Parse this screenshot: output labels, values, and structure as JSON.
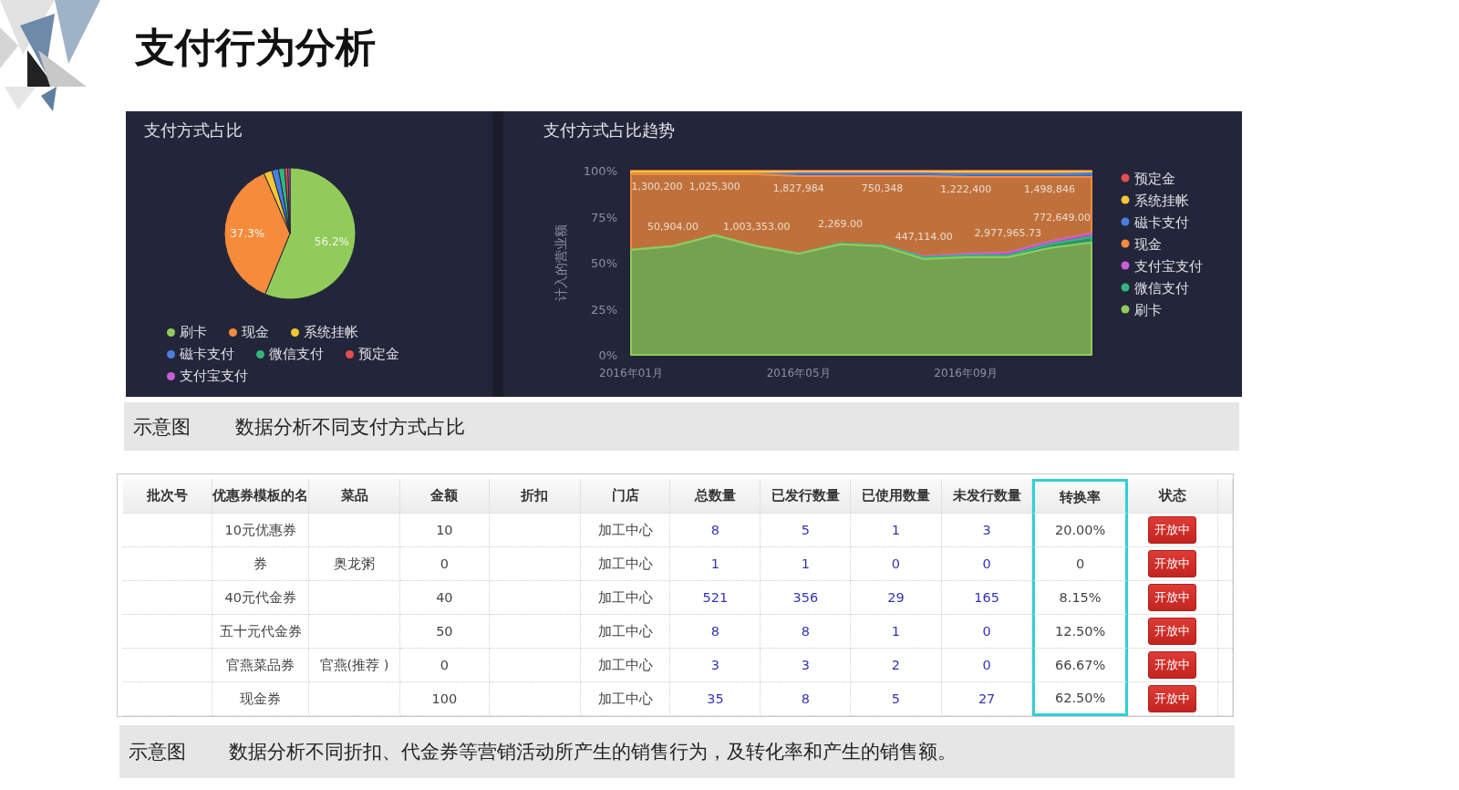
{
  "title": "支付行为分析",
  "payment_share": {
    "title": "支付方式占比",
    "slices": [
      {
        "color": "#91cc5a"
      },
      {
        "color": "#f68b3c"
      },
      {
        "color": "#f5c634"
      },
      {
        "color": "#4a7fe0"
      },
      {
        "color": "#2fb87a"
      },
      {
        "color": "#e84c4c"
      },
      {
        "color": "#c95fd6"
      }
    ],
    "chart_data": {
      "type": "pie",
      "categories": [
        "刷卡",
        "现金",
        "系统挂帐",
        "磁卡支付",
        "微信支付",
        "预定金",
        "支付宝支付"
      ],
      "values": [
        56.2,
        37.3,
        2.0,
        1.7,
        1.5,
        0.8,
        0.5
      ],
      "value_labels": [
        "56.2%",
        "37.3%",
        null,
        null,
        null,
        null,
        null
      ]
    }
  },
  "payment_trend": {
    "title": "支付方式占比趋势",
    "chart_data": {
      "type": "area",
      "stacked": true,
      "legend": "right",
      "ylabel": "计入的营业额",
      "categories": [
        "2016年01月",
        null,
        null,
        null,
        "2016年05月",
        null,
        null,
        null,
        "2016年09月",
        null,
        null,
        null
      ],
      "ylim": [
        0,
        100
      ],
      "yticks": [
        {
          "value": 0,
          "label": "0%"
        },
        {
          "value": 25,
          "label": "25%"
        },
        {
          "value": 50,
          "label": "50%"
        },
        {
          "value": 75,
          "label": "75%"
        },
        {
          "value": 100,
          "label": "100%"
        }
      ],
      "series": [
        {
          "name": "刷卡",
          "color": "#91cc5a",
          "values": [
            57,
            59,
            65,
            59,
            55,
            60,
            59,
            52,
            53,
            53,
            58,
            61
          ]
        },
        {
          "name": "微信支付",
          "color": "#2fb87a",
          "values": [
            0,
            0,
            0,
            0,
            0,
            0.5,
            0.5,
            1,
            1,
            1,
            2,
            3
          ]
        },
        {
          "name": "支付宝支付",
          "color": "#c95fd6",
          "values": [
            0,
            0,
            0,
            0,
            0,
            0,
            0,
            0.5,
            1,
            1.5,
            1.5,
            2
          ]
        },
        {
          "name": "现金",
          "color": "#f68b3c",
          "values": [
            41,
            39,
            33,
            39,
            42,
            36.5,
            37.5,
            43.5,
            41.5,
            41,
            35,
            30.5
          ]
        },
        {
          "name": "磁卡支付",
          "color": "#4a7fe0",
          "values": [
            0,
            0,
            0,
            0,
            1.5,
            1.5,
            1.5,
            1.5,
            1.5,
            1.5,
            1.5,
            2
          ]
        },
        {
          "name": "系统挂帐",
          "color": "#f5c634",
          "values": [
            1.5,
            1.5,
            1.5,
            1.5,
            1,
            1,
            1,
            1,
            1.5,
            1.5,
            1.5,
            1
          ]
        },
        {
          "name": "预定金",
          "color": "#e84c4c",
          "values": [
            0.5,
            0.5,
            0.5,
            0.5,
            0.5,
            0.5,
            0.5,
            0.5,
            0.5,
            0.5,
            0.5,
            0.5
          ]
        }
      ],
      "annotations": [
        "1,300,200",
        "50,904.00",
        "1,025,300",
        "1,003,353.00",
        "1,827,984",
        "2,269.00",
        "750,348",
        "447,114.00",
        "1,222,400",
        "2,977,965.73",
        "1,498,846",
        "772,649.00"
      ]
    }
  },
  "chart_caption": {
    "label": "示意图",
    "text": "数据分析不同支付方式占比"
  },
  "coupon_table": {
    "columns": [
      {
        "label": "批次号",
        "highlighted": false
      },
      {
        "label": "优惠券模板的名",
        "kind": "text",
        "highlighted": false
      },
      {
        "label": "菜品",
        "kind": "text",
        "highlighted": false
      },
      {
        "label": "金额",
        "kind": "text",
        "highlighted": false
      },
      {
        "label": "折扣",
        "highlighted": false
      },
      {
        "label": "门店",
        "kind": "text",
        "highlighted": false
      },
      {
        "label": "总数量",
        "kind": "count",
        "highlighted": false
      },
      {
        "label": "已发行数量",
        "kind": "count",
        "highlighted": false
      },
      {
        "label": "已使用数量",
        "kind": "count",
        "highlighted": false
      },
      {
        "label": "未发行数量",
        "kind": "count",
        "highlighted": false
      },
      {
        "label": "转换率",
        "kind": "text",
        "highlighted": true
      },
      {
        "label": "状态",
        "kind": "status",
        "highlighted": false
      }
    ],
    "rows": [
      {
        "cells": [
          null,
          "10元优惠券",
          null,
          "10",
          null,
          "加工中心",
          "8",
          "5",
          "1",
          "3",
          "20.00%",
          "开放中"
        ]
      },
      {
        "cells": [
          null,
          "券",
          "奥龙粥",
          "0",
          null,
          "加工中心",
          "1",
          "1",
          "0",
          "0",
          "0",
          "开放中"
        ]
      },
      {
        "cells": [
          null,
          "40元代金券",
          null,
          "40",
          null,
          "加工中心",
          "521",
          "356",
          "29",
          "165",
          "8.15%",
          "开放中"
        ]
      },
      {
        "cells": [
          null,
          "五十元代金券",
          null,
          "50",
          null,
          "加工中心",
          "8",
          "8",
          "1",
          "0",
          "12.50%",
          "开放中"
        ]
      },
      {
        "cells": [
          null,
          "官燕菜品券",
          "官燕(推荐 )",
          "0",
          null,
          "加工中心",
          "3",
          "3",
          "2",
          "0",
          "66.67%",
          "开放中"
        ]
      },
      {
        "cells": [
          null,
          "现金券",
          null,
          "100",
          null,
          "加工中心",
          "35",
          "8",
          "5",
          "27",
          "62.50%",
          "开放中"
        ]
      }
    ]
  },
  "table_caption": {
    "label": "示意图",
    "text": "数据分析不同折扣、代金券等营销活动所产生的销售行为，及转化率和产生的销售额。"
  }
}
